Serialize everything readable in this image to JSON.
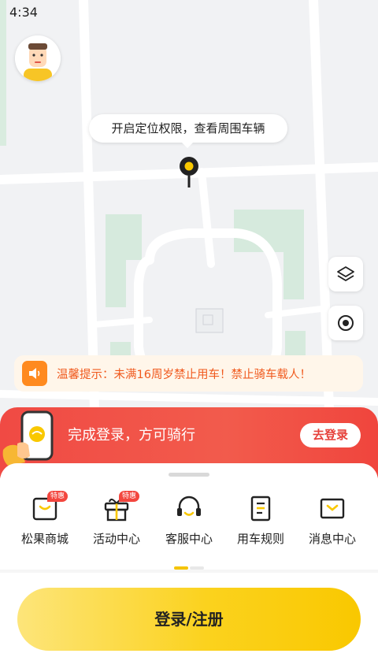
{
  "status_bar": {
    "time": "4:34"
  },
  "map": {
    "location_tip": "开启定位权限，查看周围车辆",
    "layers_icon": "layers-icon",
    "locate_icon": "locate-icon"
  },
  "notice": {
    "text": "温馨提示：未满16周岁禁止用车！禁止骑车载人！",
    "icon": "speaker-icon"
  },
  "login_banner": {
    "text": "完成登录，方可骑行",
    "button_label": "去登录"
  },
  "services": [
    {
      "label": "松果商城",
      "badge": "特惠",
      "icon": "shopping-bag-icon"
    },
    {
      "label": "活动中心",
      "badge": "特惠",
      "icon": "gift-icon"
    },
    {
      "label": "客服中心",
      "badge": "",
      "icon": "headset-icon"
    },
    {
      "label": "用车规则",
      "badge": "",
      "icon": "clipboard-icon"
    },
    {
      "label": "消息中心",
      "badge": "",
      "icon": "envelope-icon"
    }
  ],
  "pagination": {
    "current": 1,
    "total": 2
  },
  "cta": {
    "label": "登录/注册"
  },
  "colors": {
    "accent_yellow": "#F9C800",
    "banner_red": "#F04A44",
    "notice_orange": "#F05A1E"
  }
}
